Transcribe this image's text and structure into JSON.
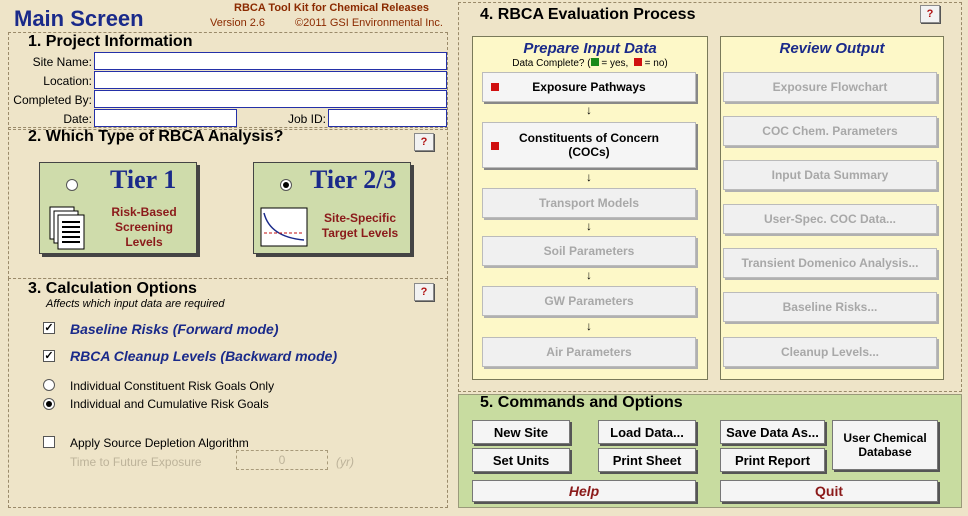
{
  "header": {
    "title": "Main Screen",
    "toolkit": "RBCA Tool Kit for Chemical Releases",
    "version": "Version 2.6",
    "copyright": "©2011 GSI Environmental Inc."
  },
  "project": {
    "heading": "1.  Project Information",
    "site_name_label": "Site Name:",
    "location_label": "Location:",
    "completed_by_label": "Completed By:",
    "date_label": "Date:",
    "job_id_label": "Job ID:",
    "site_name": "",
    "location": "",
    "completed_by": "",
    "date": "",
    "job_id": ""
  },
  "analysis": {
    "heading": "2.  Which Type of RBCA Analysis?",
    "help": "?",
    "tier1": {
      "title": "Tier 1",
      "desc1": "Risk-Based",
      "desc2": "Screening",
      "desc3": "Levels",
      "selected": false
    },
    "tier23": {
      "title": "Tier 2/3",
      "desc1": "Site-Specific",
      "desc2": "Target Levels",
      "selected": true
    }
  },
  "calc": {
    "heading": "3.  Calculation Options",
    "sub": "Affects which input data are required",
    "help": "?",
    "baseline": "Baseline Risks (Forward mode)",
    "cleanup": "RBCA Cleanup Levels (Backward mode)",
    "individual_only": "Individual Constituent Risk Goals Only",
    "individual_cumulative": "Individual and Cumulative Risk Goals",
    "depletion": "Apply Source Depletion Algorithm",
    "time_label": "Time to Future Exposure",
    "time_value": "0",
    "time_unit": "(yr)"
  },
  "evaluation": {
    "heading": "4.  RBCA Evaluation Process",
    "help": "?",
    "prepare_title": "Prepare Input Data",
    "data_complete_prefix": "Data Complete? (",
    "yes": " = yes,",
    "no": " = no)",
    "review_title": "Review Output",
    "prepare": [
      "Exposure Pathways",
      "Constituents of Concern (COCs)",
      "Transport Models",
      "Soil Parameters",
      "GW Parameters",
      "Air Parameters"
    ],
    "review": [
      "Exposure Flowchart",
      "COC Chem. Parameters",
      "Input Data Summary",
      "User-Spec. COC Data...",
      "Transient Domenico Analysis...",
      "Baseline Risks...",
      "Cleanup Levels..."
    ]
  },
  "commands": {
    "heading": "5.  Commands and Options",
    "new_site": "New Site",
    "load_data": "Load Data...",
    "save_data": "Save Data As...",
    "user_db": "User Chemical Database",
    "set_units": "Set Units",
    "print_sheet": "Print Sheet",
    "print_report": "Print Report",
    "help": "Help",
    "quit": "Quit"
  },
  "colors": {
    "status_complete": "#1a8a1a",
    "status_incomplete": "#d01010",
    "title": "#1a2a8a"
  }
}
